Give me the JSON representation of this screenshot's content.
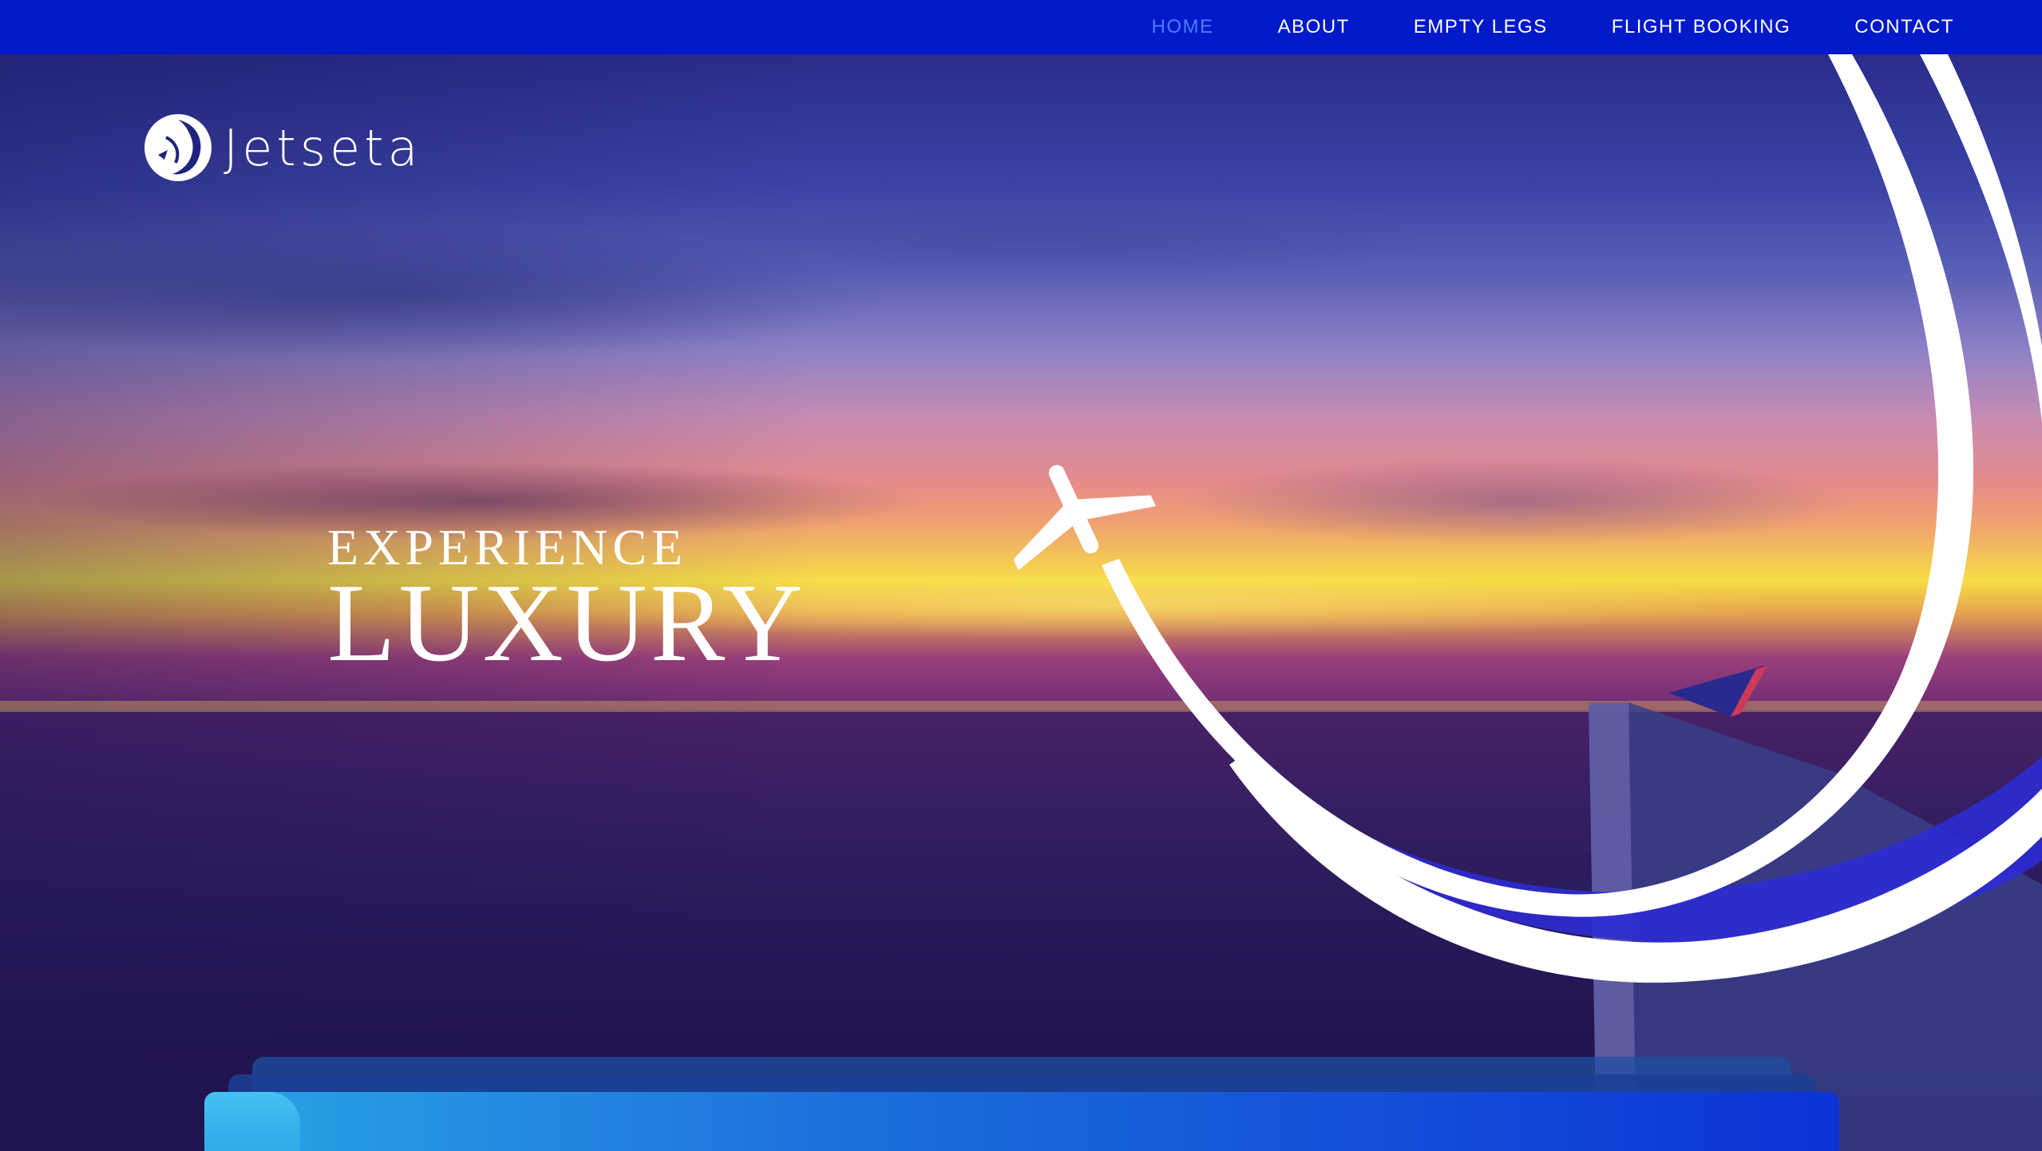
{
  "nav": {
    "items": [
      {
        "label": "HOME",
        "active": true
      },
      {
        "label": "ABOUT",
        "active": false
      },
      {
        "label": "EMPTY LEGS",
        "active": false
      },
      {
        "label": "FLIGHT BOOKING",
        "active": false
      },
      {
        "label": "CONTACT",
        "active": false
      }
    ]
  },
  "brand": {
    "name": "Jetseta",
    "logo_icon": "jetseta-logo-icon"
  },
  "hero": {
    "headline_line1": "EXPERIENCE",
    "headline_line2": "LUXURY",
    "decor_icon": "airplane-swoosh-icon"
  },
  "colors": {
    "nav_bg": "#0019c9",
    "nav_active": "#4a7dff",
    "text": "#ffffff",
    "accent_blue": "#2a2ad0"
  }
}
